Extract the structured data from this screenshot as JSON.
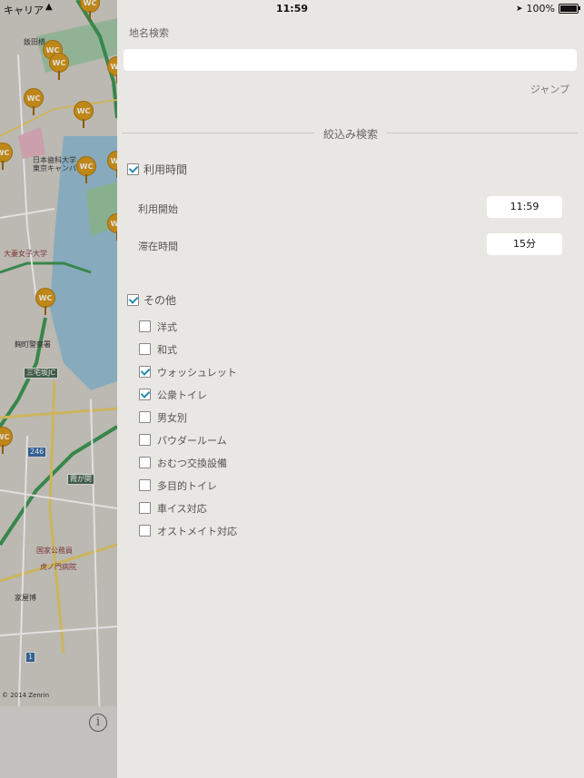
{
  "status_bar": {
    "carrier": "キャリア",
    "time": "11:59",
    "battery": "100%"
  },
  "map": {
    "pin_label": "WC",
    "labels": {
      "iidabashi": "飯田橋",
      "nihon_dental": "日本歯科大学",
      "tokyo_campus": "東京キャンパ",
      "otsuma": "大妻女子大学",
      "kojimachi_police": "麹町警察署",
      "miyakezaka": "三宅坂JC",
      "kasumigaseki": "霞が関",
      "route_246": "246",
      "national_research": "国家公務員",
      "toranomon": "虎ノ門病院",
      "azabu": "家屋博",
      "route_1": "1",
      "copyright": "© 2014 Zenrin"
    },
    "info_icon": "info-icon"
  },
  "panel": {
    "place_label": "地名検索",
    "place_input_value": "",
    "place_input_placeholder": "",
    "jump_label": "ジャンプ",
    "filter_title": "絞込み検索",
    "usage_time": {
      "label": "利用時間",
      "checked": true,
      "start_label": "利用開始",
      "start_value": "11:59",
      "stay_label": "滞在時間",
      "stay_value": "15分"
    },
    "other": {
      "label": "その他",
      "checked": true,
      "options": [
        {
          "label": "洋式",
          "checked": false
        },
        {
          "label": "和式",
          "checked": false
        },
        {
          "label": "ウォッシュレット",
          "checked": true
        },
        {
          "label": "公衆トイレ",
          "checked": true
        },
        {
          "label": "男女別",
          "checked": false
        },
        {
          "label": "パウダールーム",
          "checked": false
        },
        {
          "label": "おむつ交換設備",
          "checked": false
        },
        {
          "label": "多目的トイレ",
          "checked": false
        },
        {
          "label": "車イス対応",
          "checked": false
        },
        {
          "label": "オストメイト対応",
          "checked": false
        }
      ]
    }
  }
}
